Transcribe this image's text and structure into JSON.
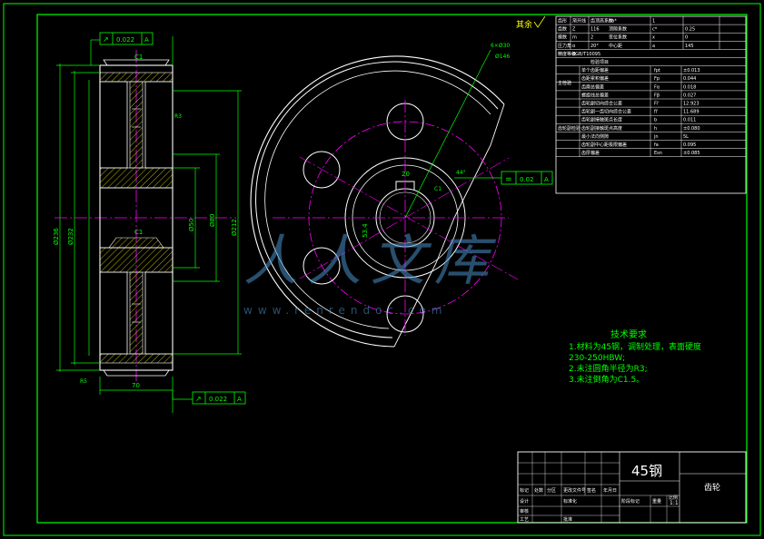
{
  "sheet": {
    "colors": {
      "background": "#000000",
      "frame": "#00ff00",
      "geometry": "#ffffff",
      "centerline": "#ff00ff",
      "dimension": "#00ff00",
      "hatch": "#ffff00",
      "text_title": "#ffffff"
    }
  },
  "roughness": {
    "other": "其余"
  },
  "tolerance_frames": {
    "top_left": {
      "symbol": "↗",
      "value": "0.022",
      "datum": "A"
    },
    "bottom_left": {
      "symbol": "↗",
      "value": "0.022",
      "datum": "A"
    },
    "keyway": {
      "symbol": "=",
      "value": "0.02",
      "datum": "A"
    }
  },
  "section_dims": {
    "c1_top": "C1",
    "c1_bottom": "C1",
    "dia_outer": "Ø236",
    "dia_root": "Ø232",
    "dia_rim": "Ø212",
    "dia_hub": "Ø80",
    "dia_bore": "Ø50",
    "width": "70",
    "r": "R3",
    "r2": "R5"
  },
  "front_dims": {
    "keyway_width": "20",
    "keyway_depth": "53.4",
    "chamfer": "C1",
    "holes": "6×Ø30",
    "pcd": "Ø146",
    "angle": "44°"
  },
  "params_table": {
    "rows": [
      [
        "齿形",
        "渐开线",
        "齿顶高系数",
        "ha*",
        "1"
      ],
      [
        "齿数",
        "Z",
        "116",
        "顶隙系数",
        "c*",
        "0.25"
      ],
      [
        "模数",
        "m",
        "2",
        "变位系数",
        "x",
        "0"
      ],
      [
        "压力角",
        "α",
        "20°",
        "中心距",
        "a",
        "145"
      ],
      [
        "精度等级",
        "8GB/T10095",
        "",
        "",
        "",
        ""
      ]
    ],
    "header_row": [
      "检验项目"
    ],
    "groups": [
      {
        "name": "主检验",
        "items": [
          [
            "单个齿距偏差",
            "fpt",
            "±0.013"
          ],
          [
            "齿距累积偏差",
            "Fp",
            "0.044"
          ],
          [
            "齿廓总偏差",
            "Fα",
            "0.018"
          ],
          [
            "螺旋线总偏差",
            "Fβ",
            "0.027"
          ]
        ]
      },
      {
        "name": "齿轮副检验",
        "items": [
          [
            "齿轮副切向综合公差",
            "Fi'",
            "12.923"
          ],
          [
            "齿轮副一齿切向综合公差",
            "fi'",
            "11.689"
          ],
          [
            "齿轮副接触斑点长度",
            "b",
            "0.011"
          ],
          [
            "齿轮副接触斑点高度",
            "h",
            "±0.080"
          ],
          [
            "最小法向侧隙",
            "jn",
            "5L"
          ],
          [
            "齿轮副中心距极限偏差",
            "fa",
            "0.095"
          ],
          [
            "齿厚偏差",
            "Esn",
            "±0.085"
          ]
        ]
      }
    ]
  },
  "tech_req": {
    "title": "技术要求",
    "lines": [
      "1.材料为45钢，调制处理，表面硬度",
      "230-250HBW;",
      "2.未注圆角半径为R3;",
      "3.未注倒角为C1.5。"
    ]
  },
  "title_block": {
    "material": "45钢",
    "part_name": "齿轮",
    "labels": [
      "标记",
      "处数",
      "分区",
      "更改文件号",
      "签名",
      "年月日",
      "设计",
      "标准化",
      "阶段标记",
      "重量",
      "比例",
      "审核",
      "工艺",
      "批准"
    ],
    "scale_value": "1:1"
  },
  "watermark": {
    "text": "人人文库",
    "url": "www.renrendoc.com"
  }
}
